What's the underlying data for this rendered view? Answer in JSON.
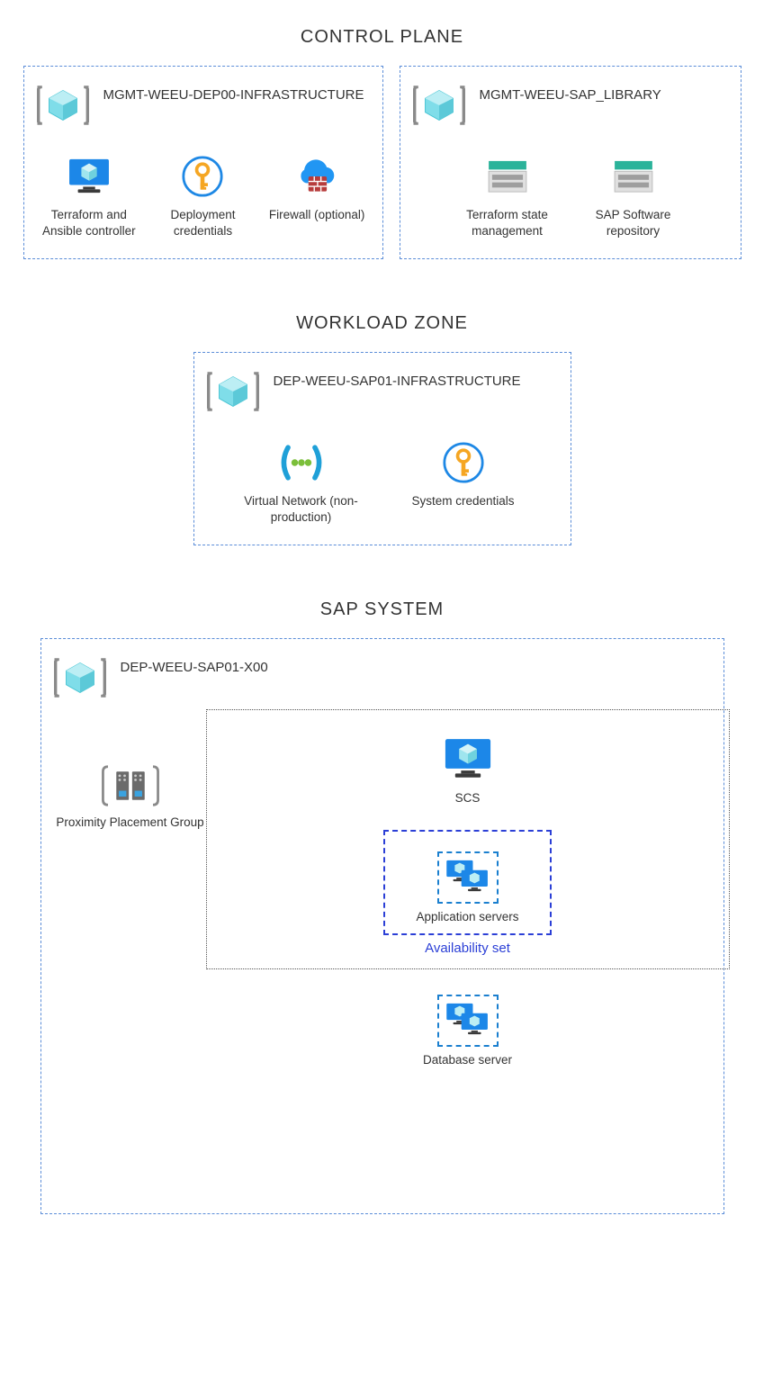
{
  "sections": {
    "control_plane": {
      "title": "CONTROL PLANE",
      "left": {
        "name": "MGMT-WEEU-DEP00-INFRASTRUCTURE",
        "items": [
          {
            "label": "Terraform and Ansible controller",
            "icon": "monitor-cube"
          },
          {
            "label": "Deployment credentials",
            "icon": "key-circle"
          },
          {
            "label": "Firewall (optional)",
            "icon": "firewall-cloud"
          }
        ]
      },
      "right": {
        "name": "MGMT-WEEU-SAP_LIBRARY",
        "items": [
          {
            "label": "Terraform state management",
            "icon": "storage"
          },
          {
            "label": "SAP Software repository",
            "icon": "storage"
          }
        ]
      }
    },
    "workload_zone": {
      "title": "WORKLOAD ZONE",
      "box": {
        "name": "DEP-WEEU-SAP01-INFRASTRUCTURE",
        "items": [
          {
            "label": "Virtual Network (non-production)",
            "icon": "vnet"
          },
          {
            "label": "System credentials",
            "icon": "key-circle"
          }
        ]
      }
    },
    "sap_system": {
      "title": "SAP SYSTEM",
      "box": {
        "name": "DEP-WEEU-SAP01-X00",
        "ppg_label": "Proximity Placement Group",
        "scs_label": "SCS",
        "app_label": "Application servers",
        "avset_label": "Availability set",
        "db_label": "Database server"
      }
    }
  }
}
